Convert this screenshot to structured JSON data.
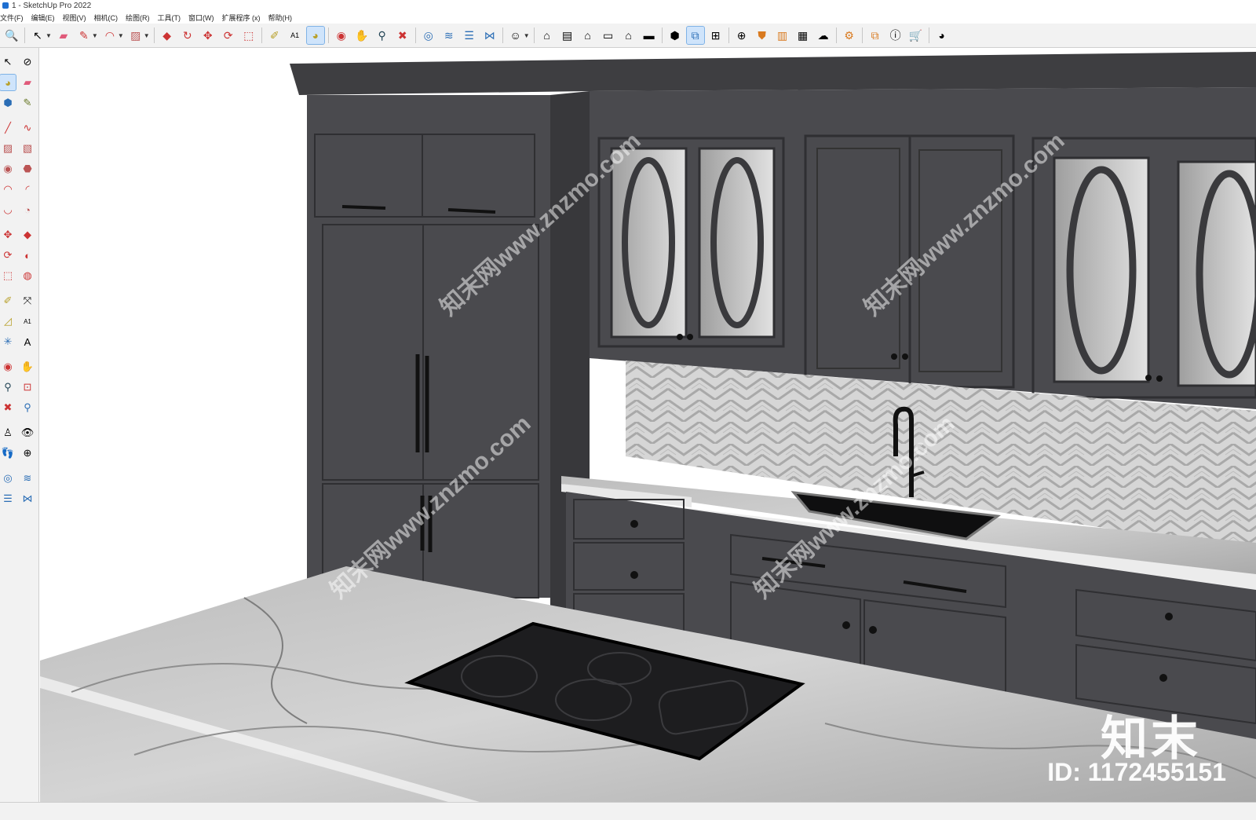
{
  "window": {
    "title": "1 - SketchUp Pro 2022"
  },
  "menu": [
    "文件(F)",
    "编辑(E)",
    "视图(V)",
    "相机(C)",
    "绘图(R)",
    "工具(T)",
    "窗口(W)",
    "扩展程序 (x)",
    "帮助(H)"
  ],
  "toolbar_icons": [
    "search-icon",
    "select-icon",
    "eraser-icon",
    "pencil-icon",
    "arc-icon",
    "rectangle-icon",
    "push-pull-icon",
    "follow-me-icon",
    "move-icon",
    "rotate-icon",
    "scale-icon",
    "tape-measure-icon",
    "text-icon",
    "paint-bucket-icon",
    "orbit-icon",
    "pan-icon",
    "zoom-icon",
    "zoom-extents-icon",
    "layers-icon",
    "outliner-icon",
    "tags-icon",
    "user-icon",
    "iso-view-icon",
    "front-view-icon",
    "home-icon",
    "right-view-icon",
    "back-view-icon",
    "left-view-icon",
    "components-icon",
    "window-icon",
    "section-icon",
    "add-icon",
    "shield-icon",
    "books-icon",
    "texture-icon",
    "cloud-icon",
    "settings-icon",
    "open-icon",
    "info-icon",
    "cart-icon",
    "account-icon"
  ],
  "left_tools": [
    "select-icon",
    "orbit-icon",
    "paint-icon",
    "eraser-icon",
    "component-icon",
    "pencil-icon",
    "line-icon",
    "freehand-icon",
    "rectangle-icon",
    "rotated-rect-icon",
    "circle-icon",
    "polygon-icon",
    "arc-icon",
    "pie-icon",
    "pushpull-icon",
    "offset-icon",
    "move-icon",
    "follow-icon",
    "rotate-icon",
    "scale-icon",
    "tape-icon",
    "dimension-icon",
    "protractor-icon",
    "text-icon",
    "axes-icon",
    "3dtext-icon",
    "orbit2-icon",
    "pan-icon",
    "zoom-icon",
    "zoomwindow-icon",
    "extents-icon",
    "prev-icon",
    "walk-icon",
    "look-icon",
    "position-icon",
    "section-icon",
    "sandbox-icon",
    "stamp-icon",
    "drape-icon",
    "flip-icon"
  ],
  "watermark": {
    "text": "知末网www.znzmo.com",
    "brand": "知末",
    "id": "ID: 1172455151"
  },
  "colors": {
    "cabinet": "#4a4a4e",
    "cabinet_dark": "#3a3a3d",
    "marble": "#dcdcdc",
    "cooktop": "#1d1d1f"
  }
}
